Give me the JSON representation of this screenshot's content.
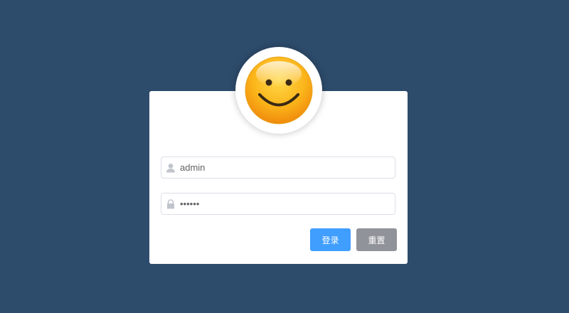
{
  "login": {
    "username": {
      "icon": "user-icon",
      "value": "admin"
    },
    "password": {
      "icon": "lock-icon",
      "value": "••••••"
    },
    "buttons": {
      "login_label": "登录",
      "reset_label": "重置"
    }
  },
  "avatar": {
    "icon": "smiley-face-icon"
  },
  "colors": {
    "background": "#2d4b6b",
    "primary": "#409eff",
    "secondary": "#909399"
  }
}
